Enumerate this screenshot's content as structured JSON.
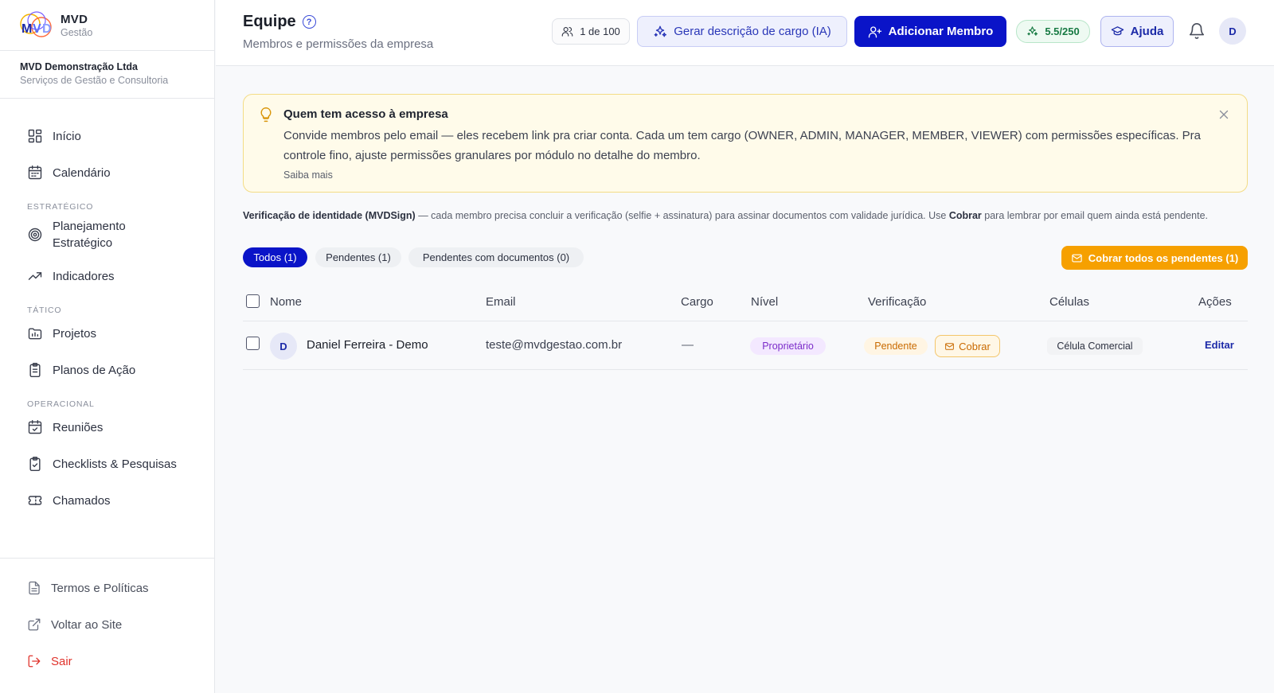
{
  "brand": {
    "name": "MVD",
    "subtitle": "Gestão"
  },
  "company": {
    "name": "MVD Demonstração Ltda",
    "subtitle": "Serviços de Gestão e Consultoria"
  },
  "nav": {
    "inicio": "Início",
    "calendario": "Calendário",
    "section_estrategico": "ESTRATÉGICO",
    "planejamento": "Planejamento Estratégico",
    "indicadores": "Indicadores",
    "section_tatico": "TÁTICO",
    "projetos": "Projetos",
    "planos": "Planos de Ação",
    "section_operacional": "OPERACIONAL",
    "reunioes": "Reuniões",
    "checklists": "Checklists & Pesquisas",
    "chamados": "Chamados"
  },
  "bottom_nav": {
    "termos": "Termos e Políticas",
    "voltar": "Voltar ao Site",
    "sair": "Sair"
  },
  "header": {
    "title": "Equipe",
    "subtitle": "Membros e permissões da empresa",
    "members_count": "1 de 100",
    "ia_button": "Gerar descrição de cargo (IA)",
    "add_button": "Adicionar Membro",
    "credits": "5.5/250",
    "help_button": "Ajuda",
    "user_initial": "D"
  },
  "banner": {
    "title": "Quem tem acesso à empresa",
    "text": "Convide membros pelo email — eles recebem link pra criar conta. Cada um tem cargo (OWNER, ADMIN, MANAGER, MEMBER, VIEWER) com permissões específicas. Pra controle fino, ajuste permissões granulares por módulo no detalhe do membro.",
    "link": "Saiba mais"
  },
  "verification_note": {
    "lead": "Verificação de identidade (MVDSign)",
    "text1": " — cada membro precisa concluir a verificação (selfie + assinatura) para assinar documentos com validade jurídica. Use ",
    "bold": "Cobrar",
    "text2": " para lembrar por email quem ainda está pendente."
  },
  "filters": {
    "all": "Todos (1)",
    "pending": "Pendentes (1)",
    "pending_docs": "Pendentes com documentos (0)",
    "remind_all": "Cobrar todos os pendentes (1)"
  },
  "table": {
    "columns": {
      "name": "Nome",
      "email": "Email",
      "role": "Cargo",
      "level": "Nível",
      "verification": "Verificação",
      "cells": "Células",
      "actions": "Ações"
    },
    "rows": [
      {
        "initial": "D",
        "name": "Daniel Ferreira - Demo",
        "email": "teste@mvdgestao.com.br",
        "role": "—",
        "level": "Proprietário",
        "verification": "Pendente",
        "remind": "Cobrar",
        "cell": "Célula Comercial",
        "action": "Editar"
      }
    ]
  },
  "colors": {
    "primary": "#0a14c8",
    "warning": "#f6a000",
    "banner_bg": "#fffbea",
    "danger": "#e0322b"
  }
}
